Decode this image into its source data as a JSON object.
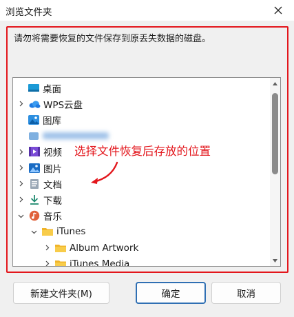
{
  "window": {
    "title": "浏览文件夹"
  },
  "instruction": "请勿将需要恢复的文件保存到原丢失数据的磁盘。",
  "tree": [
    {
      "label": "桌面",
      "icon": "desktop-icon",
      "expander": "none",
      "blurred": false
    },
    {
      "label": "WPS云盘",
      "icon": "cloud-icon",
      "expander": "collapsed",
      "blurred": false
    },
    {
      "label": "图库",
      "icon": "gallery-icon",
      "expander": "none",
      "blurred": false
    },
    {
      "label": "",
      "icon": "user-folder-icon",
      "expander": "none",
      "blurred": true
    },
    {
      "label": "视频",
      "icon": "video-icon",
      "expander": "collapsed",
      "blurred": false
    },
    {
      "label": "图片",
      "icon": "pictures-icon",
      "expander": "collapsed",
      "blurred": false
    },
    {
      "label": "文档",
      "icon": "documents-icon",
      "expander": "collapsed",
      "blurred": false
    },
    {
      "label": "下载",
      "icon": "download-icon",
      "expander": "collapsed",
      "blurred": false
    },
    {
      "label": "音乐",
      "icon": "music-icon",
      "expander": "expanded",
      "blurred": false
    },
    {
      "label": "iTunes",
      "icon": "folder-icon",
      "expander": "expanded",
      "blurred": false
    },
    {
      "label": "Album Artwork",
      "icon": "folder-icon",
      "expander": "collapsed",
      "blurred": false
    },
    {
      "label": "iTunes Media",
      "icon": "folder-icon",
      "expander": "collapsed",
      "blurred": false
    }
  ],
  "annotation": {
    "text": "选择文件恢复后存放的位置",
    "color": "#e3161c"
  },
  "buttons": {
    "new_folder": "新建文件夹(M)",
    "ok": "确定",
    "cancel": "取消"
  },
  "colors": {
    "accent": "#2f6fb3",
    "annotation_red": "#e3161c",
    "folder": "#f5c542"
  }
}
